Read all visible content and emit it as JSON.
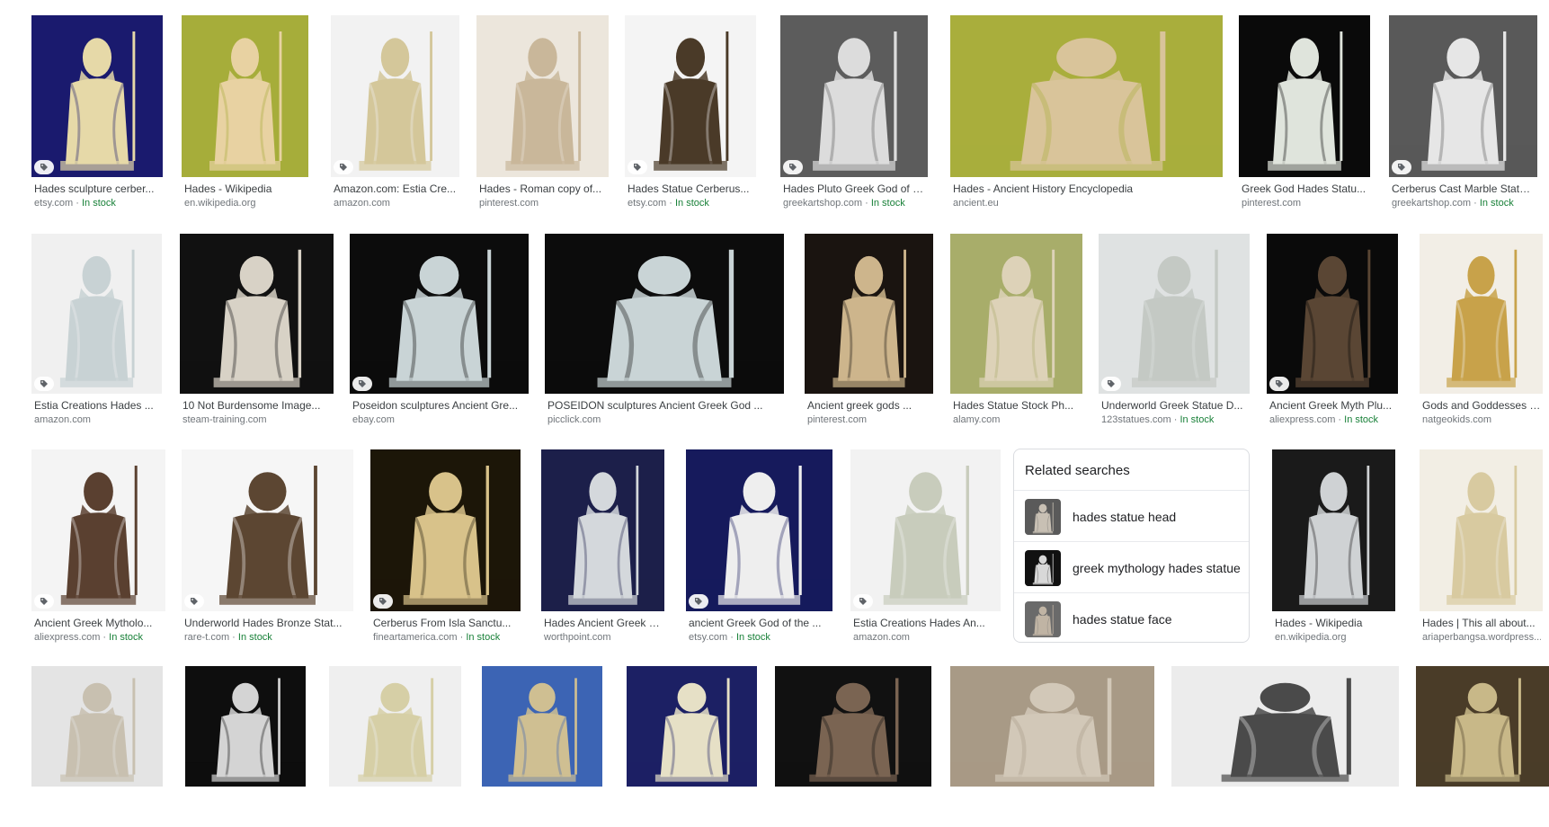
{
  "colors": {
    "in_stock": "#188038",
    "caption": "#3c4043",
    "source": "#70757a"
  },
  "rows": [
    [
      {
        "title": "Hades sculpture cerber...",
        "source": "etsy.com",
        "stock": "In stock",
        "tag": true,
        "bg": "#1a1a6e",
        "fg": "#e6d9a8"
      },
      {
        "title": "Hades - Wikipedia",
        "source": "en.wikipedia.org",
        "stock": "",
        "tag": false,
        "bg": "#a6ad3a",
        "fg": "#e8d2a2"
      },
      {
        "title": "Amazon.com: Estia Cre...",
        "source": "amazon.com",
        "stock": "",
        "tag": true,
        "bg": "#f2f2f2",
        "fg": "#d4c79a"
      },
      {
        "title": "Hades - Roman copy of...",
        "source": "pinterest.com",
        "stock": "",
        "tag": false,
        "bg": "#ece6dc",
        "fg": "#c9b79a"
      },
      {
        "title": "Hades Statue Cerberus...",
        "source": "etsy.com",
        "stock": "In stock",
        "tag": true,
        "bg": "#f4f4f4",
        "fg": "#4a3a28"
      },
      {
        "title": "Hades Pluto Greek God of Un...",
        "source": "greekartshop.com",
        "stock": "In stock",
        "tag": true,
        "bg": "#5c5c5c",
        "fg": "#dcdcdc"
      },
      {
        "title": "Hades - Ancient History Encyclopedia",
        "source": "ancient.eu",
        "stock": "",
        "tag": false,
        "bg": "#a9ae3c",
        "fg": "#d9c49a"
      },
      {
        "title": "Greek God Hades Statu...",
        "source": "pinterest.com",
        "stock": "",
        "tag": false,
        "bg": "#0a0a0a",
        "fg": "#dfe4dc"
      },
      {
        "title": "Cerberus Cast Marble Statue ...",
        "source": "greekartshop.com",
        "stock": "In stock",
        "tag": true,
        "bg": "#595959",
        "fg": "#e6e6e6"
      }
    ],
    [
      {
        "title": "Estia Creations Hades ...",
        "source": "amazon.com",
        "stock": "",
        "tag": true,
        "bg": "#f0f0f0",
        "fg": "#c8d2d4"
      },
      {
        "title": "10 Not Burdensome Image...",
        "source": "steam-training.com",
        "stock": "",
        "tag": false,
        "bg": "#111111",
        "fg": "#d8d2c6"
      },
      {
        "title": "Poseidon sculptures Ancient Gre...",
        "source": "ebay.com",
        "stock": "",
        "tag": true,
        "bg": "#0c0c0c",
        "fg": "#c9d4d6"
      },
      {
        "title": "POSEIDON sculptures Ancient Greek God ...",
        "source": "picclick.com",
        "stock": "",
        "tag": false,
        "bg": "#0c0c0c",
        "fg": "#c9d4d6"
      },
      {
        "title": "Ancient greek gods ...",
        "source": "pinterest.com",
        "stock": "",
        "tag": false,
        "bg": "#1a1410",
        "fg": "#cdb58c"
      },
      {
        "title": "Hades Statue Stock Ph...",
        "source": "alamy.com",
        "stock": "",
        "tag": false,
        "bg": "#a8ad6a",
        "fg": "#ddd2b8"
      },
      {
        "title": "Underworld Greek Statue D...",
        "source": "123statues.com",
        "stock": "In stock",
        "tag": true,
        "bg": "#dfe2e2",
        "fg": "#c4c9c4"
      },
      {
        "title": "Ancient Greek Myth Plu...",
        "source": "aliexpress.com",
        "stock": "In stock",
        "tag": true,
        "bg": "#0a0a0a",
        "fg": "#5a4634"
      },
      {
        "title": "Gods and Goddesses o...",
        "source": "natgeokids.com",
        "stock": "",
        "tag": false,
        "bg": "#f2eee6",
        "fg": "#c8a24a"
      }
    ],
    [
      {
        "title": "Ancient Greek Mytholo...",
        "source": "aliexpress.com",
        "stock": "In stock",
        "tag": true,
        "bg": "#f4f4f4",
        "fg": "#5a4030"
      },
      {
        "title": "Underworld Hades Bronze Stat...",
        "source": "rare-t.com",
        "stock": "In stock",
        "tag": true,
        "bg": "#f6f6f6",
        "fg": "#5c4632"
      },
      {
        "title": "Cerberus From Isla Sanctu...",
        "source": "fineartamerica.com",
        "stock": "In stock",
        "tag": true,
        "bg": "#1c1608",
        "fg": "#d8c28a"
      },
      {
        "title": "Hades Ancient Greek G...",
        "source": "worthpoint.com",
        "stock": "",
        "tag": false,
        "bg": "#1c1f4a",
        "fg": "#d4d8dc"
      },
      {
        "title": "ancient Greek God of the ...",
        "source": "etsy.com",
        "stock": "In stock",
        "tag": true,
        "bg": "#161a5c",
        "fg": "#eeeeee"
      },
      {
        "title": "Estia Creations Hades An...",
        "source": "amazon.com",
        "stock": "",
        "tag": true,
        "bg": "#f2f2f2",
        "fg": "#c8ccbc"
      },
      {
        "title": "Hades - Wikipedia",
        "source": "en.wikipedia.org",
        "stock": "",
        "tag": false,
        "bg": "#1a1a1a",
        "fg": "#cfd2d4"
      },
      {
        "title": "Hades | This all about...",
        "source": "ariaperbangsa.wordpress...",
        "stock": "",
        "tag": false,
        "bg": "#f2eee4",
        "fg": "#d8caa0"
      }
    ],
    [
      {
        "title": "",
        "source": "",
        "stock": "",
        "tag": false,
        "bg": "#e4e4e4",
        "fg": "#c8c0b0"
      },
      {
        "title": "",
        "source": "",
        "stock": "",
        "tag": false,
        "bg": "#0e0e0e",
        "fg": "#d4d4d4"
      },
      {
        "title": "",
        "source": "",
        "stock": "",
        "tag": false,
        "bg": "#efefef",
        "fg": "#d6cfa6"
      },
      {
        "title": "",
        "source": "",
        "stock": "",
        "tag": false,
        "bg": "#3c64b4",
        "fg": "#cfbf92"
      },
      {
        "title": "",
        "source": "",
        "stock": "",
        "tag": false,
        "bg": "#1c2064",
        "fg": "#e6e0c6"
      },
      {
        "title": "",
        "source": "",
        "stock": "",
        "tag": false,
        "bg": "#111111",
        "fg": "#7a6452"
      },
      {
        "title": "",
        "source": "",
        "stock": "",
        "tag": false,
        "bg": "#a89a86",
        "fg": "#d2c8b8"
      },
      {
        "title": "",
        "source": "",
        "stock": "",
        "tag": false,
        "bg": "#ececec",
        "fg": "#4a4a4a"
      },
      {
        "title": "",
        "source": "",
        "stock": "",
        "tag": false,
        "bg": "#4a3c28",
        "fg": "#c8b888"
      }
    ]
  ],
  "related_searches": {
    "title": "Related searches",
    "items": [
      {
        "label": "hades statue head",
        "bg": "#5a5a5a",
        "fg": "#c8c0b4"
      },
      {
        "label": "greek mythology hades statue",
        "bg": "#111111",
        "fg": "#d8d8d8"
      },
      {
        "label": "hades statue face",
        "bg": "#6a6a6a",
        "fg": "#c0b4a4"
      }
    ]
  }
}
